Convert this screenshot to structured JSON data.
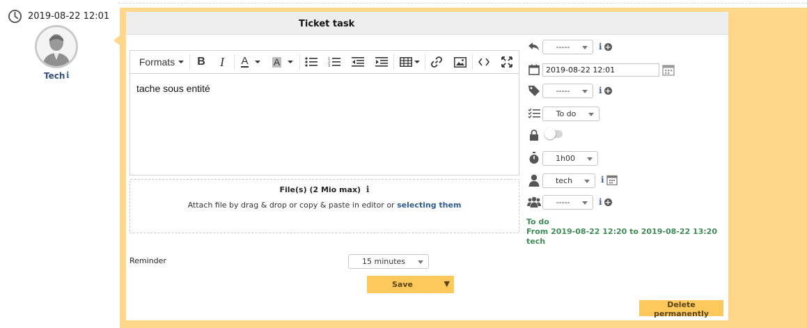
{
  "meta": {
    "timestamp": "2019-08-22 12:01",
    "user_name": "Tech"
  },
  "panel": {
    "title": "Ticket task"
  },
  "editor": {
    "formats_label": "Formats",
    "content": "tache sous entité"
  },
  "dropzone": {
    "title": "File(s) (2 Mio max)",
    "text": "Attach file by drag & drop or copy & paste in editor or",
    "link": "selecting them"
  },
  "reminder": {
    "label": "Reminder",
    "value": "15 minutes"
  },
  "buttons": {
    "save": "Save",
    "delete": "Delete permanently"
  },
  "sidebar": {
    "template_value": "-----",
    "date_value": "2019-08-22 12:01",
    "category_value": "-----",
    "status_value": "To do",
    "duration_value": "1h00",
    "user_value": "tech",
    "group_value": "-----"
  },
  "summary": {
    "status": "To do",
    "schedule": "From 2019-08-22 12:20 to 2019-08-22 13:20",
    "user": "tech"
  },
  "colors": {
    "accent": "#fed78a",
    "button": "#fec95c",
    "link": "#2f5c8f",
    "summary_text": "#3f8a56"
  }
}
